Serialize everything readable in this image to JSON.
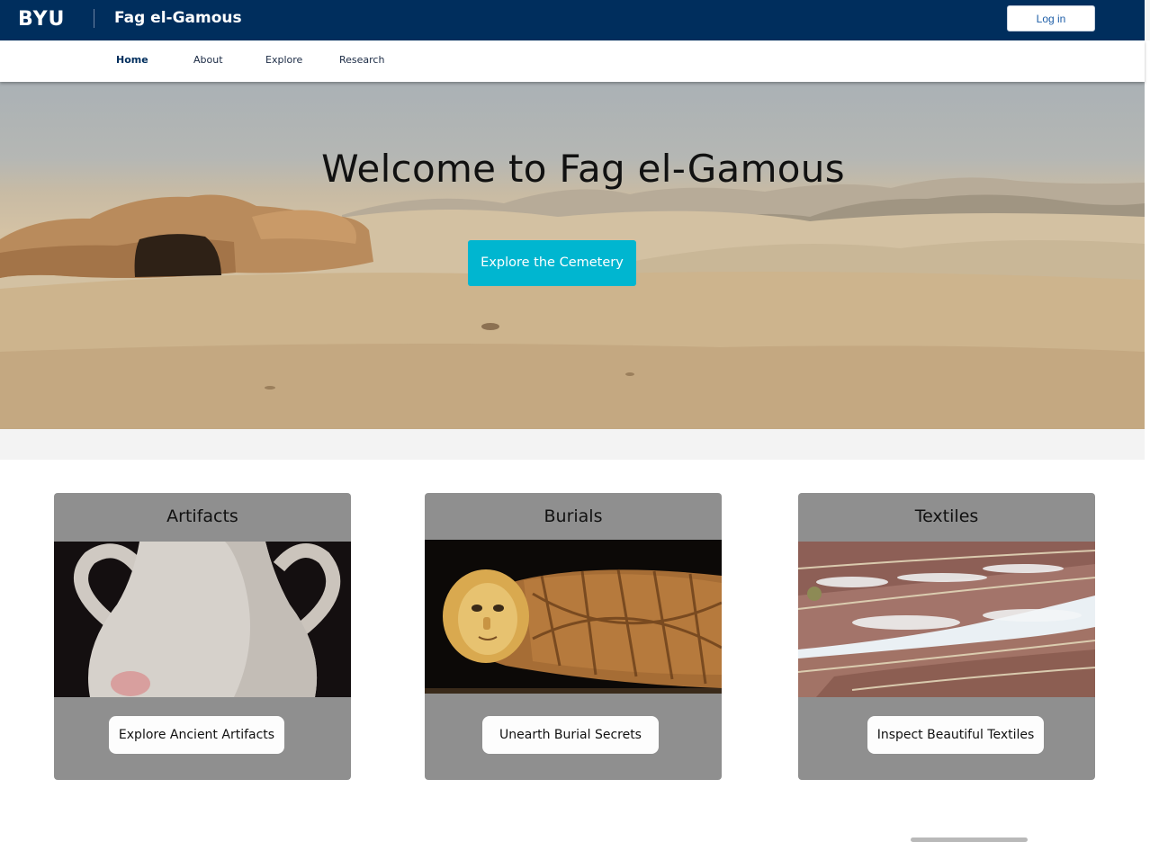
{
  "header": {
    "logo_text": "BYU",
    "site_title": "Fag el-Gamous",
    "login_label": "Log in",
    "brand_color": "#002e5d"
  },
  "nav": {
    "items": [
      {
        "label": "Home",
        "active": true
      },
      {
        "label": "About",
        "active": false
      },
      {
        "label": "Explore",
        "active": false
      },
      {
        "label": "Research",
        "active": false
      }
    ]
  },
  "hero": {
    "title": "Welcome to Fag el-Gamous",
    "cta_label": "Explore the Cemetery",
    "cta_color": "#00b6d0",
    "image": "desert-landscape-photo"
  },
  "cards": [
    {
      "title": "Artifacts",
      "image": "clay-amphora-photo",
      "button_label": "Explore Ancient Artifacts"
    },
    {
      "title": "Burials",
      "image": "mummy-sarcophagus-photo",
      "button_label": "Unearth Burial Secrets"
    },
    {
      "title": "Textiles",
      "image": "woven-textile-photo",
      "button_label": "Inspect Beautiful Textiles"
    }
  ]
}
